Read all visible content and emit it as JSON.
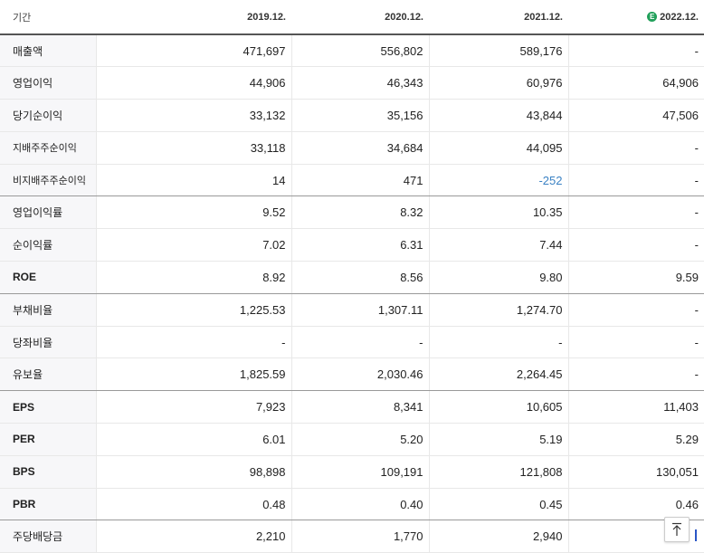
{
  "header": {
    "label": "기간",
    "years": [
      "2019.12.",
      "2020.12.",
      "2021.12.",
      "2022.12."
    ],
    "estimate_badge": "E"
  },
  "rows": [
    {
      "label": "매출액",
      "values": [
        "471,697",
        "556,802",
        "589,176",
        "-"
      ]
    },
    {
      "label": "영업이익",
      "values": [
        "44,906",
        "46,343",
        "60,976",
        "64,906"
      ]
    },
    {
      "label": "당기순이익",
      "values": [
        "33,132",
        "35,156",
        "43,844",
        "47,506"
      ]
    },
    {
      "label": "지배주주순이익",
      "values": [
        "33,118",
        "34,684",
        "44,095",
        "-"
      ]
    },
    {
      "label": "비지배주주순이익",
      "values": [
        "14",
        "471",
        "-252",
        "-"
      ]
    },
    {
      "label": "영업이익률",
      "values": [
        "9.52",
        "8.32",
        "10.35",
        "-"
      ]
    },
    {
      "label": "순이익률",
      "values": [
        "7.02",
        "6.31",
        "7.44",
        "-"
      ]
    },
    {
      "label": "ROE",
      "values": [
        "8.92",
        "8.56",
        "9.80",
        "9.59"
      ]
    },
    {
      "label": "부채비율",
      "values": [
        "1,225.53",
        "1,307.11",
        "1,274.70",
        "-"
      ]
    },
    {
      "label": "당좌비율",
      "values": [
        "-",
        "-",
        "-",
        "-"
      ]
    },
    {
      "label": "유보율",
      "values": [
        "1,825.59",
        "2,030.46",
        "2,264.45",
        "-"
      ]
    },
    {
      "label": "EPS",
      "values": [
        "7,923",
        "8,341",
        "10,605",
        "11,403"
      ]
    },
    {
      "label": "PER",
      "values": [
        "6.01",
        "5.20",
        "5.19",
        "5.29"
      ]
    },
    {
      "label": "BPS",
      "values": [
        "98,898",
        "109,191",
        "121,808",
        "130,051"
      ]
    },
    {
      "label": "PBR",
      "values": [
        "0.48",
        "0.40",
        "0.45",
        "0.46"
      ]
    },
    {
      "label": "주당배당금",
      "values": [
        "2,210",
        "1,770",
        "2,940",
        ""
      ]
    }
  ],
  "colors": {
    "negative": "#3b82c4",
    "estimate_badge": "#21a05a",
    "label_bg": "#f7f7f9"
  },
  "icons": {
    "scroll_top": "arrow-up-icon"
  }
}
